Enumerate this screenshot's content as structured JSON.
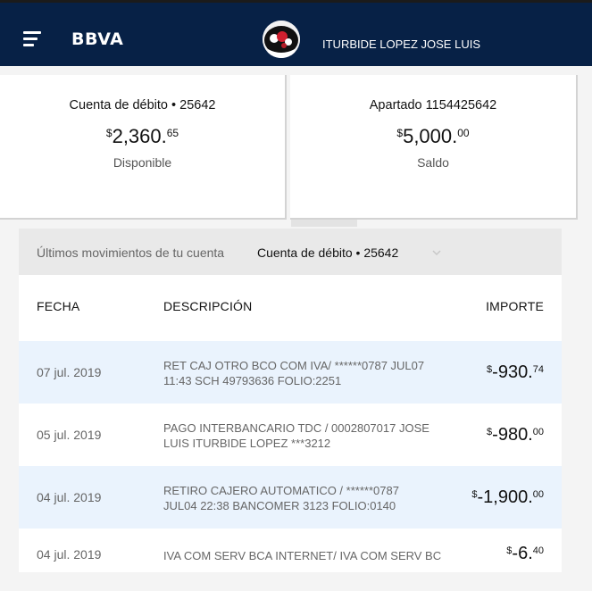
{
  "header": {
    "brand": "BBVA",
    "user_name": "ITURBIDE LOPEZ JOSE LUIS",
    "bg_color": "#072146"
  },
  "accounts": [
    {
      "title": "Cuenta de débito • 25642",
      "currency": "$",
      "amount": "2,360.",
      "cents": "65",
      "label": "Disponible"
    },
    {
      "title": "Apartado 1154425642",
      "currency": "$",
      "amount": "5,000.",
      "cents": "00",
      "label": "Saldo"
    }
  ],
  "movements": {
    "filter_label": "Últimos movimientos de tu cuenta",
    "filter_value": "Cuenta de débito • 25642",
    "columns": {
      "date": "FECHA",
      "description": "DESCRIPCIÓN",
      "amount": "IMPORTE"
    },
    "rows": [
      {
        "date": "07 jul. 2019",
        "desc1": "RET CAJ OTRO BCO COM IVA/ ******0787 JUL07",
        "desc2": "11:43 SCH 49793636 FOLIO:2251",
        "currency": "$",
        "amount": "-930.",
        "cents": "74"
      },
      {
        "date": "05 jul. 2019",
        "desc1": "PAGO INTERBANCARIO TDC / 0002807017 JOSE",
        "desc2": "LUIS ITURBIDE LOPEZ ***3212",
        "currency": "$",
        "amount": "-980.",
        "cents": "00"
      },
      {
        "date": "04 jul. 2019",
        "desc1": "RETIRO CAJERO AUTOMATICO / ******0787",
        "desc2": "JUL04 22:38 BANCOMER 3123 FOLIO:0140",
        "currency": "$",
        "amount": "-1,900.",
        "cents": "00"
      },
      {
        "date": "04 jul. 2019",
        "desc1": "IVA COM SERV BCA INTERNET/ IVA COM SERV BC",
        "desc2": "",
        "currency": "$",
        "amount": "-6.",
        "cents": "40"
      }
    ]
  }
}
